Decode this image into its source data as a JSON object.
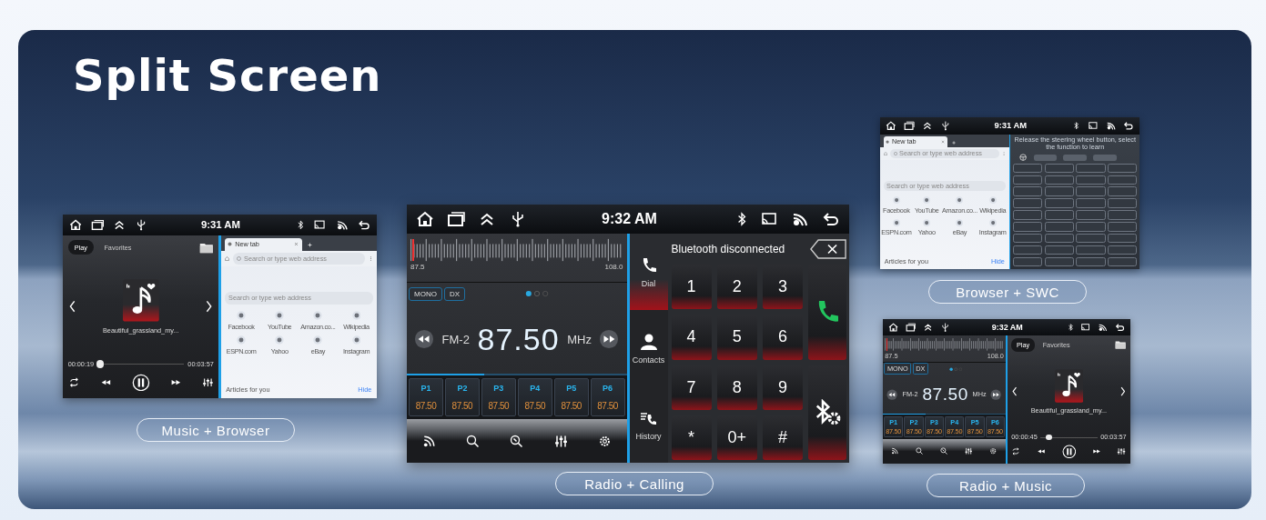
{
  "title": "Split Screen",
  "screens": [
    {
      "caption": "Music + Browser",
      "time": "9:31 AM",
      "panels": [
        {
          "kind": "music",
          "tabs": [
            {
              "label": "Play",
              "selected": true
            },
            {
              "label": "Favorites",
              "selected": false
            }
          ],
          "song": "Beautiful_grassland_my...",
          "elapsed": "00:00:19",
          "total": "00:03:57",
          "level": 0.03
        },
        {
          "kind": "browser",
          "tab": "New tab",
          "address_placeholder": "Search or type web address",
          "search_placeholder": "Search or type web address",
          "shortcuts": [
            "Facebook",
            "YouTube",
            "Amazon.co...",
            "Wikipedia",
            "ESPN.com",
            "Yahoo",
            "eBay",
            "Instagram"
          ],
          "articles": "Articles for you",
          "hide": "Hide"
        }
      ]
    },
    {
      "caption": "Radio + Calling",
      "time": "9:32 AM",
      "panels": [
        {
          "kind": "radio",
          "scale_start": "87.5",
          "scale_end": "108.0",
          "level": 0.01,
          "modes": [
            "MONO",
            "DX"
          ],
          "band": "FM-2",
          "frequency": "87.50",
          "unit": "MHz",
          "presets": [
            {
              "name": "P1",
              "frequency": "87.50"
            },
            {
              "name": "P2",
              "frequency": "87.50"
            },
            {
              "name": "P3",
              "frequency": "87.50"
            },
            {
              "name": "P4",
              "frequency": "87.50"
            },
            {
              "name": "P5",
              "frequency": "87.50"
            },
            {
              "name": "P6",
              "frequency": "87.50"
            }
          ]
        },
        {
          "kind": "dialer",
          "nav": [
            {
              "label": "Dial",
              "selected": true
            },
            {
              "label": "Contacts",
              "selected": false
            },
            {
              "label": "History",
              "selected": false
            }
          ],
          "status": "Bluetooth disconnected",
          "keys": [
            "1",
            "2",
            "3",
            "4",
            "5",
            "6",
            "7",
            "8",
            "9",
            "*",
            "0+",
            "#"
          ]
        }
      ]
    },
    {
      "caption": "Browser + SWC",
      "time": "9:31 AM",
      "panels": [
        {
          "kind": "browser",
          "tab": "New tab",
          "address_placeholder": "Search or type web address",
          "search_placeholder": "Search or type web address",
          "shortcuts": [
            "Facebook",
            "YouTube",
            "Amazon.co...",
            "Wikipedia",
            "ESPN.com",
            "Yahoo",
            "eBay",
            "Instagram"
          ],
          "articles": "Articles for you",
          "hide": "Hide"
        },
        {
          "kind": "swc",
          "instruction": "Release the steering wheel button, select the function to learn"
        }
      ]
    },
    {
      "caption": "Radio + Music",
      "time": "9:32 AM",
      "panels": [
        {
          "kind": "radio",
          "scale_start": "87.5",
          "scale_end": "108.0",
          "level": 0.01,
          "modes": [
            "MONO",
            "DX"
          ],
          "band": "FM-2",
          "frequency": "87.50",
          "unit": "MHz",
          "presets": [
            {
              "name": "P1",
              "frequency": "87.50"
            },
            {
              "name": "P2",
              "frequency": "87.50"
            },
            {
              "name": "P3",
              "frequency": "87.50"
            },
            {
              "name": "P4",
              "frequency": "87.50"
            },
            {
              "name": "P5",
              "frequency": "87.50"
            },
            {
              "name": "P6",
              "frequency": "87.50"
            }
          ]
        },
        {
          "kind": "music",
          "tabs": [
            {
              "label": "Play",
              "selected": true
            },
            {
              "label": "Favorites",
              "selected": false
            }
          ],
          "song": "Beautiful_grassland_my...",
          "elapsed": "00:00:45",
          "total": "00:03:57",
          "level": 0.15
        }
      ]
    }
  ]
}
